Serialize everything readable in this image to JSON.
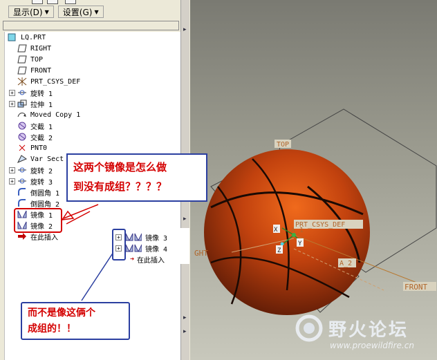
{
  "toolbar": {
    "display_label": "显示(D)",
    "settings_label": "设置(G)"
  },
  "tree": {
    "items": [
      {
        "label": "LQ.PRT",
        "icon": "part-icon",
        "indent": 0,
        "expand": ""
      },
      {
        "label": "RIGHT",
        "icon": "datum-plane-icon",
        "indent": 1,
        "expand": ""
      },
      {
        "label": "TOP",
        "icon": "datum-plane-icon",
        "indent": 1,
        "expand": ""
      },
      {
        "label": "FRONT",
        "icon": "datum-plane-icon",
        "indent": 1,
        "expand": ""
      },
      {
        "label": "PRT_CSYS_DEF",
        "icon": "csys-icon",
        "indent": 1,
        "expand": ""
      },
      {
        "label": "旋转 1",
        "icon": "revolve-icon",
        "indent": 1,
        "expand": "+"
      },
      {
        "label": "拉伸 1",
        "icon": "extrude-icon",
        "indent": 1,
        "expand": "+"
      },
      {
        "label": "Moved Copy 1",
        "icon": "moved-copy-icon",
        "indent": 1,
        "expand": ""
      },
      {
        "label": "交截 1",
        "icon": "intersect-icon",
        "indent": 1,
        "expand": ""
      },
      {
        "label": "交截 2",
        "icon": "intersect-icon",
        "indent": 1,
        "expand": ""
      },
      {
        "label": "PNT0",
        "icon": "datum-point-icon",
        "indent": 1,
        "expand": ""
      },
      {
        "label": "Var Sect",
        "icon": "sweep-icon",
        "indent": 1,
        "expand": ""
      },
      {
        "label": "旋转 2",
        "icon": "revolve-icon",
        "indent": 1,
        "expand": "+"
      },
      {
        "label": "旋转 3",
        "icon": "revolve-icon",
        "indent": 1,
        "expand": "+"
      },
      {
        "label": "倒圆角 1",
        "icon": "round-icon",
        "indent": 1,
        "expand": ""
      },
      {
        "label": "倒圆角 2",
        "icon": "round-icon",
        "indent": 1,
        "expand": ""
      },
      {
        "label": "镜像 1",
        "icon": "mirror-icon",
        "indent": 1,
        "expand": ""
      },
      {
        "label": "镜像 2",
        "icon": "mirror-icon",
        "indent": 1,
        "expand": ""
      },
      {
        "label": "在此插入",
        "icon": "insert-here-icon",
        "indent": 1,
        "expand": ""
      }
    ]
  },
  "inset": {
    "items": [
      {
        "label": "镜像 3"
      },
      {
        "label": "镜像 4"
      },
      {
        "label": "在此插入"
      }
    ]
  },
  "callouts": {
    "top_line1": "这两个镜像是怎么做",
    "top_line2": "到没有成组？？？？",
    "bottom_line1": "而不是像这俩个",
    "bottom_line2": "成组的！！"
  },
  "viewport": {
    "labels": {
      "top": "TOP",
      "csys": "PRT_CSYS_DEF",
      "a1": "A_1",
      "a2": "A_2",
      "right": "GHT",
      "front": "FRONT",
      "x": "X",
      "y": "Y",
      "z": "Z"
    }
  },
  "watermark": {
    "name": "野火论坛",
    "url": "www.proewildfire.cn"
  },
  "colors": {
    "annotation_red": "#d40000",
    "annotation_blue": "#2b3fa0",
    "ball": "#c2420e"
  }
}
